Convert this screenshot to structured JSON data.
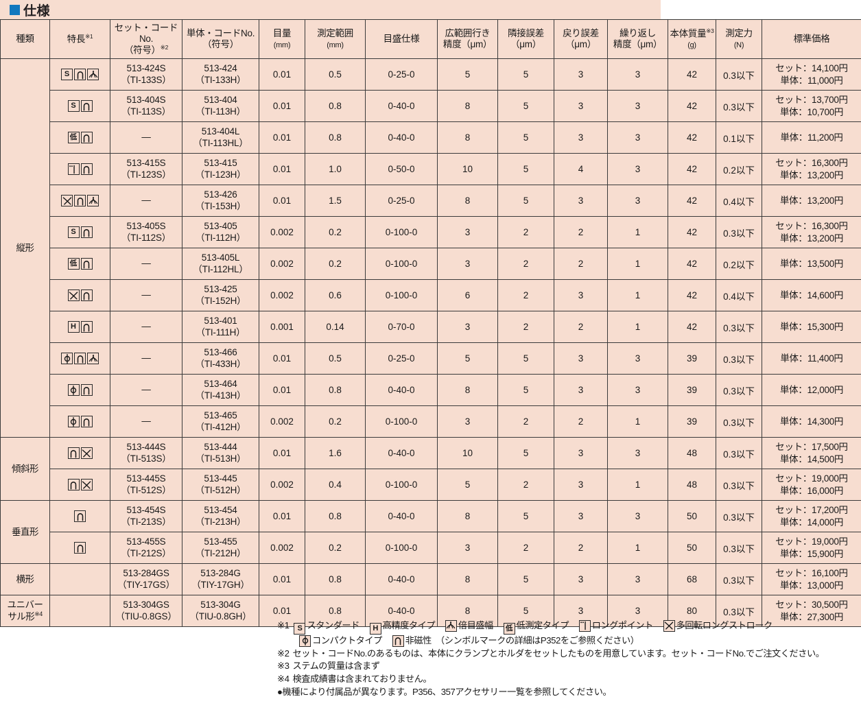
{
  "title": "仕様",
  "header": {
    "kind": "種類",
    "feature": "特長",
    "feature_note": "※1",
    "set_code_l1": "セット・コードNo.",
    "set_code_l2": "（符号）",
    "set_code_note": "※2",
    "single_code_l1": "単体・コードNo.",
    "single_code_l2": "（符号）",
    "graduation_l1": "目量",
    "graduation_l2": "(mm)",
    "range_l1": "測定範囲",
    "range_l2": "(mm)",
    "dial_spec": "目盛仕様",
    "wide_acc_l1": "広範囲行き",
    "wide_acc_l2": "精度（μm）",
    "adj_err_l1": "隣接誤差",
    "adj_err_l2": "（μm）",
    "ret_err_l1": "戻り誤差",
    "ret_err_l2": "（μm）",
    "repeat_l1": "繰り返し",
    "repeat_l2": "精度（μm）",
    "mass_l1": "本体質量",
    "mass_note": "※3",
    "mass_l2": "(g)",
    "force_l1": "測定力",
    "force_l2": "(N)",
    "price": "標準価格"
  },
  "groups": [
    {
      "kind": "縦形",
      "kind_note": "",
      "rowspan": 12
    },
    {
      "kind": "傾斜形",
      "kind_note": "",
      "rowspan": 2
    },
    {
      "kind": "垂直形",
      "kind_note": "",
      "rowspan": 2
    },
    {
      "kind": "横形",
      "kind_note": "",
      "rowspan": 1
    },
    {
      "kind": "ユニバー\nサル形",
      "kind_note": "※4",
      "rowspan": 1
    }
  ],
  "rows": [
    {
      "group": 0,
      "symbols": [
        "standard",
        "non-magnetic",
        "double-scale"
      ],
      "set_code": "513-424S",
      "set_sym": "（TI-133S）",
      "unit_code": "513-424",
      "unit_sym": "（TI-133H）",
      "grad": "0.01",
      "range": "0.5",
      "dial": "0-25-0",
      "wide": "5",
      "adj": "5",
      "ret": "3",
      "rep": "3",
      "mass": "42",
      "force": "0.3以下",
      "price": [
        "セット：14,100円",
        "単体：11,000円"
      ]
    },
    {
      "group": 0,
      "symbols": [
        "standard",
        "non-magnetic"
      ],
      "set_code": "513-404S",
      "set_sym": "（TI-113S）",
      "unit_code": "513-404",
      "unit_sym": "（TI-113H）",
      "grad": "0.01",
      "range": "0.8",
      "dial": "0-40-0",
      "wide": "8",
      "adj": "5",
      "ret": "3",
      "rep": "3",
      "mass": "42",
      "force": "0.3以下",
      "price": [
        "セット：13,700円",
        "単体：10,700円"
      ]
    },
    {
      "group": 0,
      "symbols": [
        "low-force",
        "non-magnetic"
      ],
      "set_code": "—",
      "set_sym": "",
      "unit_code": "513-404L",
      "unit_sym": "（TI-113HL）",
      "grad": "0.01",
      "range": "0.8",
      "dial": "0-40-0",
      "wide": "8",
      "adj": "5",
      "ret": "3",
      "rep": "3",
      "mass": "42",
      "force": "0.1以下",
      "price": [
        "単体：11,200円"
      ]
    },
    {
      "group": 0,
      "symbols": [
        "long-point",
        "non-magnetic"
      ],
      "set_code": "513-415S",
      "set_sym": "（TI-123S）",
      "unit_code": "513-415",
      "unit_sym": "（TI-123H）",
      "grad": "0.01",
      "range": "1.0",
      "dial": "0-50-0",
      "wide": "10",
      "adj": "5",
      "ret": "4",
      "rep": "3",
      "mass": "42",
      "force": "0.2以下",
      "price": [
        "セット：16,300円",
        "単体：13,200円"
      ]
    },
    {
      "group": 0,
      "symbols": [
        "multi-rotation",
        "non-magnetic",
        "double-scale"
      ],
      "set_code": "—",
      "set_sym": "",
      "unit_code": "513-426",
      "unit_sym": "（TI-153H）",
      "grad": "0.01",
      "range": "1.5",
      "dial": "0-25-0",
      "wide": "8",
      "adj": "5",
      "ret": "3",
      "rep": "3",
      "mass": "42",
      "force": "0.4以下",
      "price": [
        "単体：13,200円"
      ]
    },
    {
      "group": 0,
      "symbols": [
        "standard",
        "non-magnetic"
      ],
      "set_code": "513-405S",
      "set_sym": "（TI-112S）",
      "unit_code": "513-405",
      "unit_sym": "（TI-112H）",
      "grad": "0.002",
      "range": "0.2",
      "dial": "0-100-0",
      "wide": "3",
      "adj": "2",
      "ret": "2",
      "rep": "1",
      "mass": "42",
      "force": "0.3以下",
      "price": [
        "セット：16,300円",
        "単体：13,200円"
      ]
    },
    {
      "group": 0,
      "symbols": [
        "low-force",
        "non-magnetic"
      ],
      "set_code": "—",
      "set_sym": "",
      "unit_code": "513-405L",
      "unit_sym": "（TI-112HL）",
      "grad": "0.002",
      "range": "0.2",
      "dial": "0-100-0",
      "wide": "3",
      "adj": "2",
      "ret": "2",
      "rep": "1",
      "mass": "42",
      "force": "0.2以下",
      "price": [
        "単体：13,500円"
      ]
    },
    {
      "group": 0,
      "symbols": [
        "multi-rotation",
        "non-magnetic"
      ],
      "set_code": "—",
      "set_sym": "",
      "unit_code": "513-425",
      "unit_sym": "（TI-152H）",
      "grad": "0.002",
      "range": "0.6",
      "dial": "0-100-0",
      "wide": "6",
      "adj": "2",
      "ret": "3",
      "rep": "1",
      "mass": "42",
      "force": "0.4以下",
      "price": [
        "単体：14,600円"
      ]
    },
    {
      "group": 0,
      "symbols": [
        "high-accuracy",
        "non-magnetic"
      ],
      "set_code": "—",
      "set_sym": "",
      "unit_code": "513-401",
      "unit_sym": "（TI-111H）",
      "grad": "0.001",
      "range": "0.14",
      "dial": "0-70-0",
      "wide": "3",
      "adj": "2",
      "ret": "2",
      "rep": "1",
      "mass": "42",
      "force": "0.3以下",
      "price": [
        "単体：15,300円"
      ]
    },
    {
      "group": 0,
      "symbols": [
        "compact",
        "non-magnetic",
        "double-scale"
      ],
      "set_code": "—",
      "set_sym": "",
      "unit_code": "513-466",
      "unit_sym": "（TI-433H）",
      "grad": "0.01",
      "range": "0.5",
      "dial": "0-25-0",
      "wide": "5",
      "adj": "5",
      "ret": "3",
      "rep": "3",
      "mass": "39",
      "force": "0.3以下",
      "price": [
        "単体：11,400円"
      ]
    },
    {
      "group": 0,
      "symbols": [
        "compact",
        "non-magnetic"
      ],
      "set_code": "—",
      "set_sym": "",
      "unit_code": "513-464",
      "unit_sym": "（TI-413H）",
      "grad": "0.01",
      "range": "0.8",
      "dial": "0-40-0",
      "wide": "8",
      "adj": "5",
      "ret": "3",
      "rep": "3",
      "mass": "39",
      "force": "0.3以下",
      "price": [
        "単体：12,000円"
      ]
    },
    {
      "group": 0,
      "symbols": [
        "compact",
        "non-magnetic"
      ],
      "set_code": "—",
      "set_sym": "",
      "unit_code": "513-465",
      "unit_sym": "（TI-412H）",
      "grad": "0.002",
      "range": "0.2",
      "dial": "0-100-0",
      "wide": "3",
      "adj": "2",
      "ret": "2",
      "rep": "1",
      "mass": "39",
      "force": "0.3以下",
      "price": [
        "単体：14,300円"
      ]
    },
    {
      "group": 1,
      "symbols": [
        "non-magnetic",
        "multi-rotation"
      ],
      "set_code": "513-444S",
      "set_sym": "（TI-513S）",
      "unit_code": "513-444",
      "unit_sym": "（TI-513H）",
      "grad": "0.01",
      "range": "1.6",
      "dial": "0-40-0",
      "wide": "10",
      "adj": "5",
      "ret": "3",
      "rep": "3",
      "mass": "48",
      "force": "0.3以下",
      "price": [
        "セット：17,500円",
        "単体：14,500円"
      ]
    },
    {
      "group": 1,
      "symbols": [
        "non-magnetic",
        "multi-rotation"
      ],
      "set_code": "513-445S",
      "set_sym": "（TI-512S）",
      "unit_code": "513-445",
      "unit_sym": "（TI-512H）",
      "grad": "0.002",
      "range": "0.4",
      "dial": "0-100-0",
      "wide": "5",
      "adj": "2",
      "ret": "3",
      "rep": "1",
      "mass": "48",
      "force": "0.3以下",
      "price": [
        "セット：19,000円",
        "単体：16,000円"
      ]
    },
    {
      "group": 2,
      "symbols": [
        "non-magnetic"
      ],
      "set_code": "513-454S",
      "set_sym": "（TI-213S）",
      "unit_code": "513-454",
      "unit_sym": "（TI-213H）",
      "grad": "0.01",
      "range": "0.8",
      "dial": "0-40-0",
      "wide": "8",
      "adj": "5",
      "ret": "3",
      "rep": "3",
      "mass": "50",
      "force": "0.3以下",
      "price": [
        "セット：17,200円",
        "単体：14,000円"
      ]
    },
    {
      "group": 2,
      "symbols": [
        "non-magnetic"
      ],
      "set_code": "513-455S",
      "set_sym": "（TI-212S）",
      "unit_code": "513-455",
      "unit_sym": "（TI-212H）",
      "grad": "0.002",
      "range": "0.2",
      "dial": "0-100-0",
      "wide": "3",
      "adj": "2",
      "ret": "2",
      "rep": "1",
      "mass": "50",
      "force": "0.3以下",
      "price": [
        "セット：19,000円",
        "単体：15,900円"
      ]
    },
    {
      "group": 3,
      "symbols": [],
      "set_code": "513-284GS",
      "set_sym": "（TIY-17GS）",
      "unit_code": "513-284G",
      "unit_sym": "（TIY-17GH）",
      "grad": "0.01",
      "range": "0.8",
      "dial": "0-40-0",
      "wide": "8",
      "adj": "5",
      "ret": "3",
      "rep": "3",
      "mass": "68",
      "force": "0.3以下",
      "price": [
        "セット：16,100円",
        "単体：13,000円"
      ]
    },
    {
      "group": 4,
      "symbols": [],
      "set_code": "513-304GS",
      "set_sym": "（TIU-0.8GS）",
      "unit_code": "513-304G",
      "unit_sym": "（TIU-0.8GH）",
      "grad": "0.01",
      "range": "0.8",
      "dial": "0-40-0",
      "wide": "8",
      "adj": "5",
      "ret": "3",
      "rep": "3",
      "mass": "80",
      "force": "0.3以下",
      "price": [
        "セット：30,500円",
        "単体：27,300円"
      ]
    }
  ],
  "notes": {
    "n1_label": "※1",
    "n1_items": [
      {
        "sym": "standard",
        "text": "スタンダード"
      },
      {
        "sym": "high-accuracy",
        "text": "高精度タイプ"
      },
      {
        "sym": "double-scale",
        "text": "倍目盛幅"
      },
      {
        "sym": "low-force",
        "text": "低測定タイプ"
      },
      {
        "sym": "long-point",
        "text": "ロングポイント"
      },
      {
        "sym": "multi-rotation",
        "text": "多回転ロングストローク"
      }
    ],
    "n1_items2": [
      {
        "sym": "compact",
        "text": "コンパクトタイプ"
      },
      {
        "sym": "non-magnetic",
        "text": "非磁性"
      }
    ],
    "n1_tail": "（シンボルマークの詳細はP352をご参照ください）",
    "n2_label": "※2",
    "n2_text": "セット・コードNo.のあるものは、本体にクランプとホルダをセットしたものを用意しています。セット・コードNo.でご注文ください。",
    "n3_label": "※3",
    "n3_text": "ステムの質量は含まず",
    "n4_label": "※4",
    "n4_text": "検査成績書は含まれておりません。",
    "n5_text": "●機種により付属品が異なります。P356、357アクセサリー一覧を参照してください。"
  },
  "colors": {
    "bg": "#f7ddd0",
    "code_green": "#a8dc90",
    "code_text": "#0b5a1e",
    "title_square": "#1278be",
    "rule": "#000000"
  }
}
